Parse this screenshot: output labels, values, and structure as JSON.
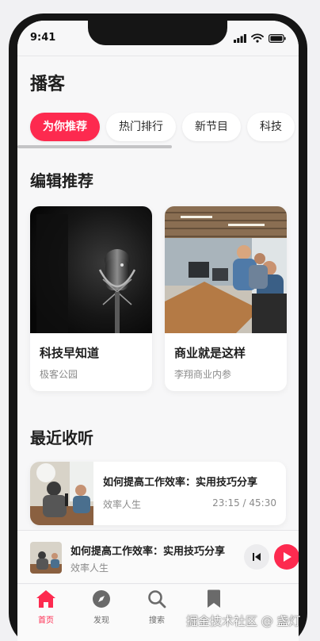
{
  "status_bar": {
    "time": "9:41"
  },
  "page": {
    "title": "播客"
  },
  "tabs": [
    {
      "label": "为你推荐",
      "active": true
    },
    {
      "label": "热门排行",
      "active": false
    },
    {
      "label": "新节目",
      "active": false
    },
    {
      "label": "科技",
      "active": false
    }
  ],
  "editor_picks": {
    "title": "编辑推荐",
    "cards": [
      {
        "title": "科技早知道",
        "author": "极客公园",
        "image": "studio-microphone-image"
      },
      {
        "title": "商业就是这样",
        "author": "李翔商业内参",
        "image": "office-meeting-image"
      }
    ]
  },
  "recent": {
    "title": "最近收听",
    "items": [
      {
        "title": "如何提高工作效率：实用技巧分享",
        "podcast": "效率人生",
        "progress": "23:15 / 45:30",
        "image": "podcast-studio-image"
      }
    ]
  },
  "mini_player": {
    "title": "如何提高工作效率：实用技巧分享",
    "podcast": "效率人生"
  },
  "tabbar": [
    {
      "label": "首页",
      "icon": "home-icon",
      "active": true
    },
    {
      "label": "发现",
      "icon": "compass-icon",
      "active": false
    },
    {
      "label": "搜索",
      "icon": "search-icon",
      "active": false
    },
    {
      "label": "",
      "icon": "bookmark-icon",
      "active": false
    }
  ],
  "watermark": "掘金技术社区 @ 盏灯",
  "colors": {
    "accent": "#fd2a4f",
    "background": "#f7f7f8",
    "text_secondary": "#8a8a8a"
  }
}
